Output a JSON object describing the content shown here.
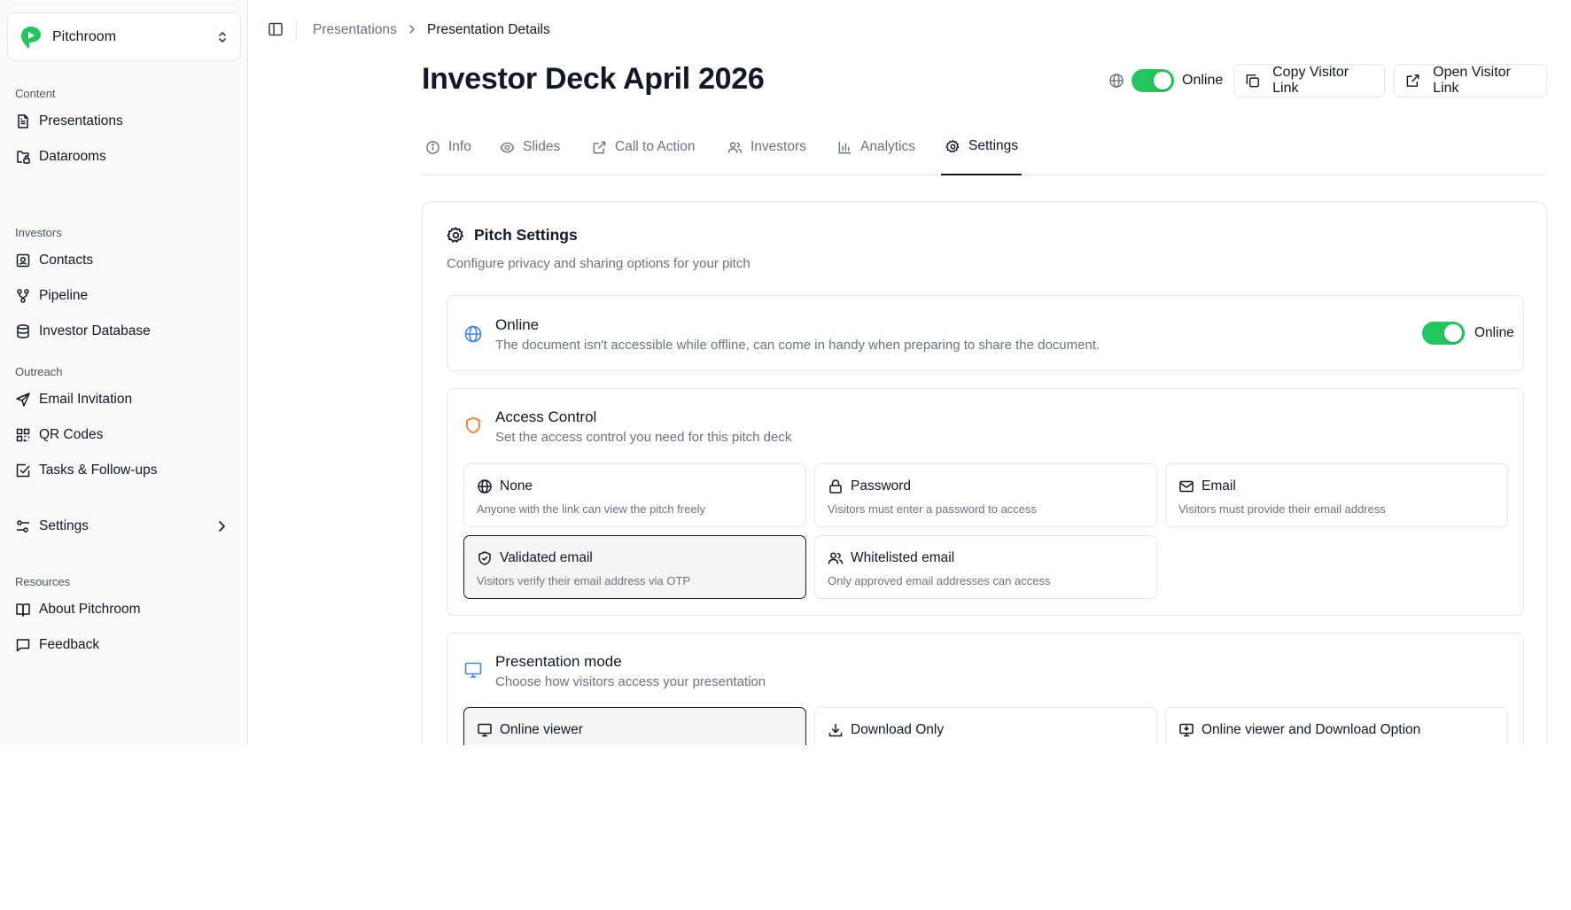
{
  "brand": {
    "name": "Pitchroom",
    "logo_color": "#22c55e"
  },
  "sidebar": {
    "sections": [
      {
        "heading": "Content",
        "items": [
          {
            "label": "Presentations",
            "icon": "file-text-icon"
          },
          {
            "label": "Datarooms",
            "icon": "folder-lock-icon"
          }
        ]
      },
      {
        "heading": "Investors",
        "items": [
          {
            "label": "Contacts",
            "icon": "contact-icon"
          },
          {
            "label": "Pipeline",
            "icon": "workflow-icon"
          },
          {
            "label": "Investor Database",
            "icon": "database-icon"
          }
        ]
      },
      {
        "heading": "Outreach",
        "items": [
          {
            "label": "Email Invitation",
            "icon": "send-icon"
          },
          {
            "label": "QR Codes",
            "icon": "qr-code-icon"
          },
          {
            "label": "Tasks & Follow-ups",
            "icon": "check-square-icon"
          }
        ]
      },
      {
        "heading": "",
        "items": [
          {
            "label": "Settings",
            "icon": "settings-sliders-icon"
          }
        ]
      },
      {
        "heading": "Resources",
        "items": [
          {
            "label": "About Pitchroom",
            "icon": "book-icon"
          },
          {
            "label": "Feedback",
            "icon": "message-square-icon"
          }
        ]
      }
    ]
  },
  "breadcrumb": {
    "parent": "Presentations",
    "current": "Presentation Details"
  },
  "header": {
    "title": "Investor Deck April 2026",
    "status_label": "Online",
    "copy_link_label": "Copy Visitor Link",
    "open_link_label": "Open Visitor Link",
    "toggle_color": "#22c55e"
  },
  "tabs": [
    {
      "label": "Info",
      "icon": "info-icon"
    },
    {
      "label": "Slides",
      "icon": "eye-icon"
    },
    {
      "label": "Call to Action",
      "icon": "external-link-icon"
    },
    {
      "label": "Investors",
      "icon": "users-icon"
    },
    {
      "label": "Analytics",
      "icon": "bar-chart-icon"
    },
    {
      "label": "Settings",
      "icon": "gear-icon",
      "active": true
    }
  ],
  "settings": {
    "title": "Pitch Settings",
    "subtitle": "Configure privacy and sharing options for your pitch",
    "online": {
      "title": "Online",
      "description": "The document isn't accessible while offline, can come in handy when preparing to share the document.",
      "toggle_label": "Online"
    },
    "access_control": {
      "title": "Access Control",
      "description": "Set the access control you need for this pitch deck",
      "options": [
        {
          "title": "None",
          "description": "Anyone with the link can view the pitch freely",
          "icon": "globe-icon"
        },
        {
          "title": "Password",
          "description": "Visitors must enter a password to access",
          "icon": "lock-icon"
        },
        {
          "title": "Email",
          "description": "Visitors must provide their email address",
          "icon": "mail-icon"
        },
        {
          "title": "Validated email",
          "description": "Visitors verify their email address via OTP",
          "icon": "shield-check-icon",
          "selected": true
        },
        {
          "title": "Whitelisted email",
          "description": "Only approved email addresses can access",
          "icon": "users-icon"
        }
      ]
    },
    "presentation_mode": {
      "title": "Presentation mode",
      "description": "Choose how visitors access your presentation",
      "options": [
        {
          "title": "Online viewer",
          "icon": "monitor-icon",
          "selected": true
        },
        {
          "title": "Download Only",
          "icon": "download-icon"
        },
        {
          "title": "Online viewer and Download Option",
          "icon": "monitor-download-icon"
        }
      ]
    }
  }
}
